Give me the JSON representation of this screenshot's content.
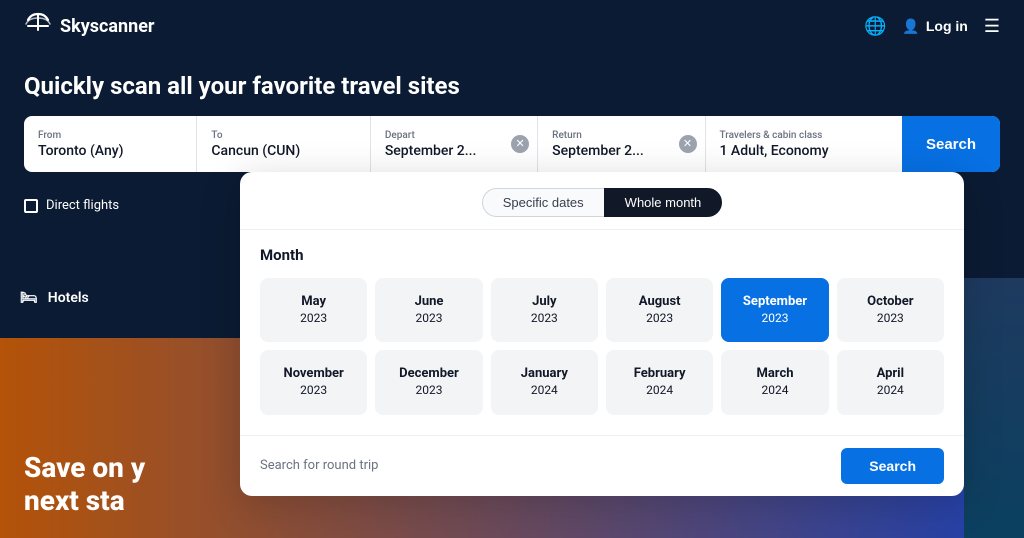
{
  "header": {
    "logo_text": "Skyscanner",
    "login_label": "Log in"
  },
  "hero": {
    "title": "Quickly scan all your favorite travel sites"
  },
  "search_bar": {
    "from_label": "From",
    "from_value": "Toronto (Any)",
    "to_label": "To",
    "to_value": "Cancun (CUN)",
    "depart_label": "Depart",
    "depart_value": "September 2...",
    "return_label": "Return",
    "return_value": "September 2...",
    "travelers_label": "Travelers & cabin class",
    "travelers_value": "1 Adult, Economy",
    "search_label": "Search"
  },
  "direct_flights_label": "Direct flights",
  "hotels_label": "Hotels",
  "bg_text_line1": "Save on y",
  "bg_text_line2": "next sta",
  "calendar": {
    "tab_specific": "Specific dates",
    "tab_whole": "Whole month",
    "month_section_label": "Month",
    "footer_text": "Search for round trip",
    "footer_search_label": "Search",
    "months": [
      {
        "name": "May",
        "year": "2023",
        "selected": false
      },
      {
        "name": "June",
        "year": "2023",
        "selected": false
      },
      {
        "name": "July",
        "year": "2023",
        "selected": false
      },
      {
        "name": "August",
        "year": "2023",
        "selected": false
      },
      {
        "name": "September",
        "year": "2023",
        "selected": true
      },
      {
        "name": "October",
        "year": "2023",
        "selected": false
      },
      {
        "name": "November",
        "year": "2023",
        "selected": false
      },
      {
        "name": "December",
        "year": "2023",
        "selected": false
      },
      {
        "name": "January",
        "year": "2024",
        "selected": false
      },
      {
        "name": "February",
        "year": "2024",
        "selected": false
      },
      {
        "name": "March",
        "year": "2024",
        "selected": false
      },
      {
        "name": "April",
        "year": "2024",
        "selected": false
      }
    ]
  }
}
